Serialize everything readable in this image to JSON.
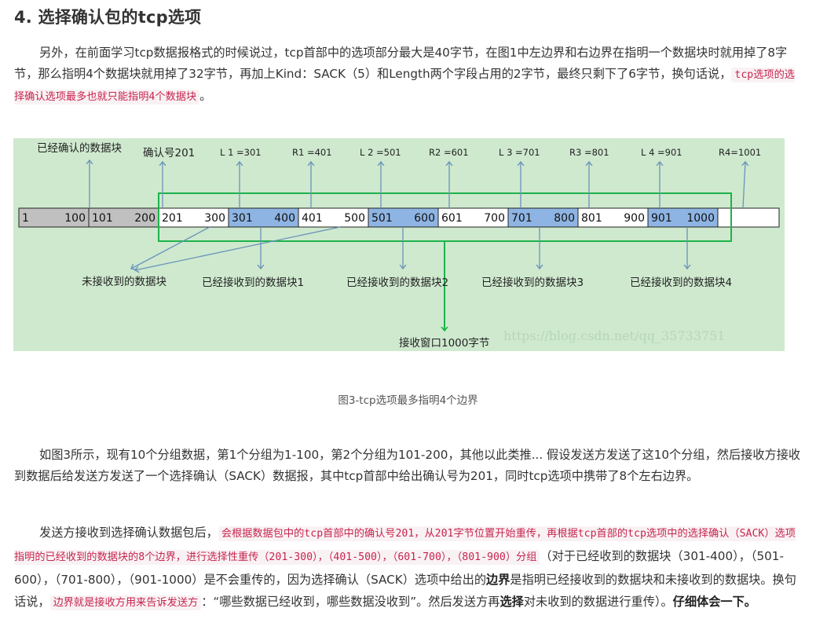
{
  "title": "4. 选择确认包的tcp选项",
  "para1": {
    "text": "另外，在前面学习tcp数据报格式的时候说过，tcp首部中的选项部分最大是40字节，在图1中左边界和右边界在指明一个数据块时就用掉了8字节，那么指明4个数据块就用掉了32字节，再加上Kind：SACK（5）和Length两个字段占用的2字节，最终只剩下了6字节，换句话说，",
    "code": "tcp选项的选择确认选项最多也就只能指明4个数据块",
    "end": "。"
  },
  "figure": {
    "cells": [
      {
        "left": "1",
        "right": "100"
      },
      {
        "left": "101",
        "right": "200"
      },
      {
        "left": "201",
        "right": "300"
      },
      {
        "left": "301",
        "right": "400"
      },
      {
        "left": "401",
        "right": "500"
      },
      {
        "left": "501",
        "right": "600"
      },
      {
        "left": "601",
        "right": "700"
      },
      {
        "left": "701",
        "right": "800"
      },
      {
        "left": "801",
        "right": "900"
      },
      {
        "left": "901",
        "right": "1000"
      }
    ],
    "top_labels": {
      "acked": "已经确认的数据块",
      "ack_no": "确认号201",
      "l1": "L 1 =301",
      "r1": "R1 =401",
      "l2": "L 2 =501",
      "r2": "R2 =601",
      "l3": "L 3 =701",
      "r3": "R3 =801",
      "l4": "L 4 =901",
      "r4": "R4=1001"
    },
    "bottom_labels": {
      "not_received": "未接收到的数据块",
      "recv1": "已经接收到的数据块1",
      "recv2": "已经接收到的数据块2",
      "recv3": "已经接收到的数据块3",
      "recv4": "已经接收到的数据块4"
    },
    "window_label": "接收窗口1000字节",
    "watermark": "https://blog.csdn.net/qq_35733751",
    "colors": {
      "background": "#cfe9cf",
      "grey_cell": "#c0c0c0",
      "blue_cell": "#8eb4e3",
      "window_border": "#1db34a",
      "arrow": "#6a93b8"
    }
  },
  "caption": "图3-tcp选项最多指明4个边界",
  "para2": {
    "text": "如图3所示，现有10个分组数据，第1个分组为1-100，第2个分组为101-200，其他以此类推... 假设发送方发送了这10个分组，然后接收方接收到数据后给发送方发送了一个选择确认（SACK）数据报，其中tcp首部中给出确认号为201，同时tcp选项中携带了8个左右边界。"
  },
  "para3": {
    "t1": "发送方接收到选择确认数据包后，",
    "code1": "会根据数据包中的tcp首部中的确认号201，从201字节位置开始重传，再根据tcp首部的tcp选项中的选择确认（SACK）选项指明的已经收到的数据块的8个边界，进行选择性重传（201-300），（401-500），（601-700），（801-900）分组",
    "t2": "（对于已经收到的数据块（301-400），（501-600），（701-800），（901-1000）是不会重传的，因为选择确认（SACK）选项中给出的",
    "bold1": "边界",
    "t3": "是指明已经接收到的数据块和未接收到的数据块。换句话说，",
    "code2": "边界就是接收方用来告诉发送方",
    "t4": "：“哪些数据已经收到，哪些数据没收到”。然后发送方再",
    "bold2": "选择",
    "t5": "对未收到的数据进行重传）。",
    "bold3": "仔细体会一下。"
  }
}
